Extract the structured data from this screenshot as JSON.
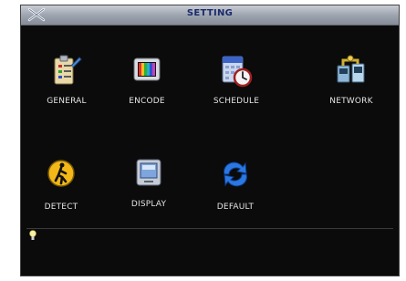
{
  "window": {
    "title": "SETTING"
  },
  "menu": {
    "items": [
      {
        "label": "GENERAL",
        "icon": "general-icon"
      },
      {
        "label": "ENCODE",
        "icon": "encode-icon"
      },
      {
        "label": "SCHEDULE",
        "icon": "schedule-icon"
      },
      {
        "label": "NETWORK",
        "icon": "network-icon"
      },
      {
        "label": "DETECT",
        "icon": "detect-icon"
      },
      {
        "label": "DISPLAY",
        "icon": "display-icon"
      },
      {
        "label": "DEFAULT",
        "icon": "default-icon"
      }
    ]
  },
  "colors": {
    "background": "#0b0b0b",
    "titlebar": "#9ba2ad",
    "title_text": "#1a2a6c",
    "label_text": "#e6e6e6"
  }
}
